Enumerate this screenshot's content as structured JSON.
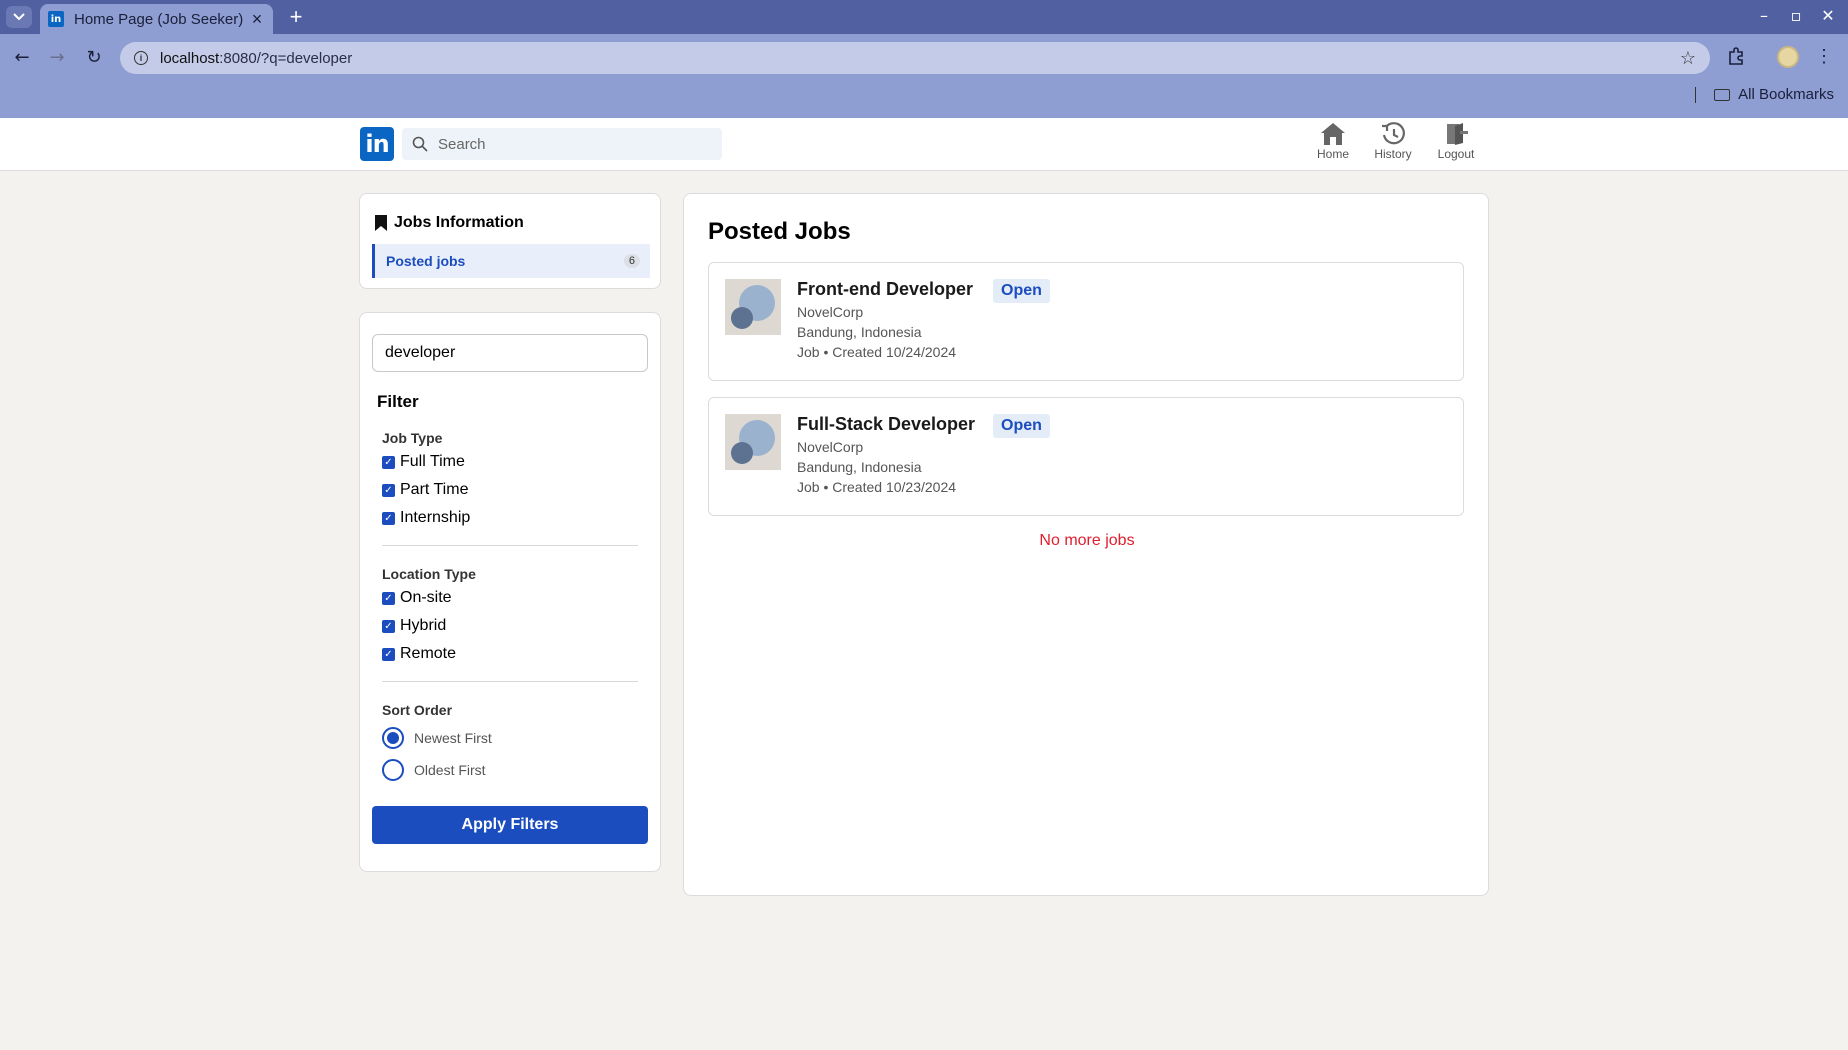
{
  "browser": {
    "tab_title": "Home Page (Job Seeker)",
    "url_host": "localhost",
    "url_rest": ":8080/?q=developer",
    "bookmarks_label": "All Bookmarks"
  },
  "header": {
    "logo_text": "in",
    "search_placeholder": "Search",
    "nav": [
      {
        "label": "Home",
        "icon": "home-icon"
      },
      {
        "label": "History",
        "icon": "history-icon"
      },
      {
        "label": "Logout",
        "icon": "logout-icon"
      }
    ]
  },
  "sidebar": {
    "title": "Jobs Information",
    "items": [
      {
        "label": "Posted jobs",
        "count": "6"
      }
    ]
  },
  "filters": {
    "search_value": "developer",
    "heading": "Filter",
    "job_type": {
      "title": "Job Type",
      "options": [
        {
          "label": "Full Time",
          "checked": true
        },
        {
          "label": "Part Time",
          "checked": true
        },
        {
          "label": "Internship",
          "checked": true
        }
      ]
    },
    "location_type": {
      "title": "Location Type",
      "options": [
        {
          "label": "On-site",
          "checked": true
        },
        {
          "label": "Hybrid",
          "checked": true
        },
        {
          "label": "Remote",
          "checked": true
        }
      ]
    },
    "sort_order": {
      "title": "Sort Order",
      "options": [
        {
          "label": "Newest First",
          "selected": true
        },
        {
          "label": "Oldest First",
          "selected": false
        }
      ]
    },
    "apply_label": "Apply Filters"
  },
  "main": {
    "title": "Posted Jobs",
    "jobs": [
      {
        "title": "Front-end Developer",
        "status": "Open",
        "company": "NovelCorp",
        "location": "Bandung, Indonesia",
        "meta": "Job • Created 10/24/2024"
      },
      {
        "title": "Full-Stack Developer",
        "status": "Open",
        "company": "NovelCorp",
        "location": "Bandung, Indonesia",
        "meta": "Job • Created 10/23/2024"
      }
    ],
    "end_message": "No more jobs"
  },
  "colors": {
    "brand": "#0a66c2",
    "accent": "#1b4dbf",
    "error_text": "#e01e2c"
  }
}
